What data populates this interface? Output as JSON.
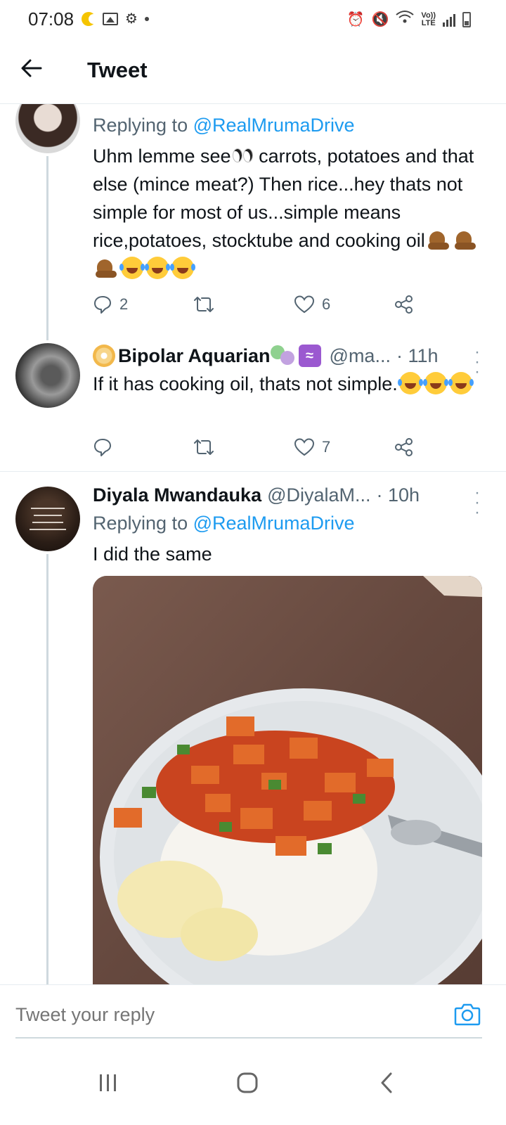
{
  "status_bar": {
    "time": "07:08",
    "lte_label_top": "Vo))",
    "lte_label_bottom": "LTE"
  },
  "header": {
    "title": "Tweet"
  },
  "tweets": [
    {
      "reply_prefix": "Replying to ",
      "reply_handle": "@RealMrumaDrive",
      "text_part1": "Uhm lemme see",
      "text_part2": " carrots, potatoes and that else (mince meat?) Then rice...hey thats not simple for most of us...simple means rice,potatoes, stocktube and cooking oil",
      "replies": "2",
      "retweets": "",
      "likes": "6"
    },
    {
      "name": "Bipolar Aquarian",
      "handle": "@ma...",
      "time": "· 11h",
      "text": "If it has cooking oil, thats not simple.",
      "replies": "",
      "retweets": "",
      "likes": "7"
    },
    {
      "name": "Diyala Mwandauka",
      "handle": "@DiyalaM...",
      "time": "· 10h",
      "reply_prefix": "Replying to ",
      "reply_handle": "@RealMrumaDrive",
      "text": "I did the same"
    }
  ],
  "reply_bar": {
    "placeholder": "Tweet your reply"
  },
  "colors": {
    "link": "#1d9bf0",
    "secondary_text": "#536471",
    "thread_line": "#cfd9de"
  }
}
